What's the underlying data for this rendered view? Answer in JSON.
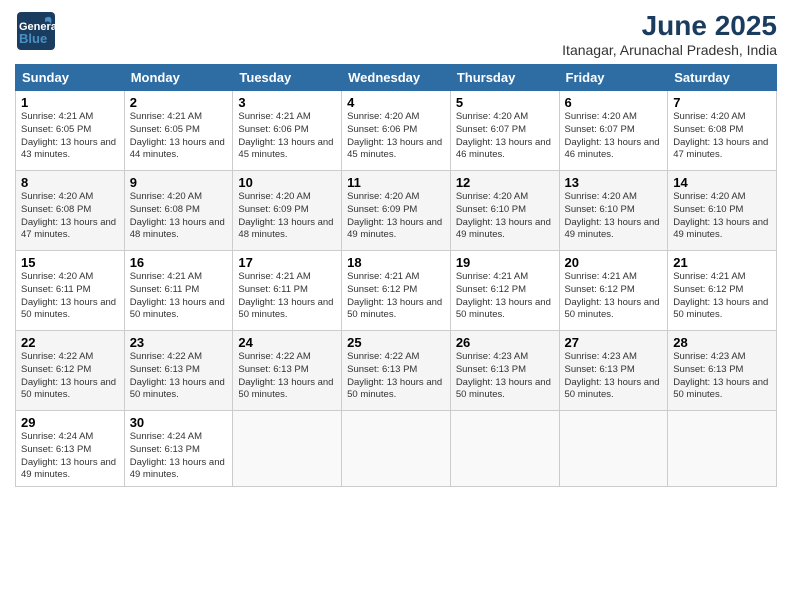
{
  "header": {
    "logo_general": "General",
    "logo_blue": "Blue",
    "month_year": "June 2025",
    "location": "Itanagar, Arunachal Pradesh, India"
  },
  "weekdays": [
    "Sunday",
    "Monday",
    "Tuesday",
    "Wednesday",
    "Thursday",
    "Friday",
    "Saturday"
  ],
  "weeks": [
    [
      {
        "day": "1",
        "sunrise": "4:21 AM",
        "sunset": "6:05 PM",
        "daylight": "13 hours and 43 minutes."
      },
      {
        "day": "2",
        "sunrise": "4:21 AM",
        "sunset": "6:05 PM",
        "daylight": "13 hours and 44 minutes."
      },
      {
        "day": "3",
        "sunrise": "4:21 AM",
        "sunset": "6:06 PM",
        "daylight": "13 hours and 45 minutes."
      },
      {
        "day": "4",
        "sunrise": "4:20 AM",
        "sunset": "6:06 PM",
        "daylight": "13 hours and 45 minutes."
      },
      {
        "day": "5",
        "sunrise": "4:20 AM",
        "sunset": "6:07 PM",
        "daylight": "13 hours and 46 minutes."
      },
      {
        "day": "6",
        "sunrise": "4:20 AM",
        "sunset": "6:07 PM",
        "daylight": "13 hours and 46 minutes."
      },
      {
        "day": "7",
        "sunrise": "4:20 AM",
        "sunset": "6:08 PM",
        "daylight": "13 hours and 47 minutes."
      }
    ],
    [
      {
        "day": "8",
        "sunrise": "4:20 AM",
        "sunset": "6:08 PM",
        "daylight": "13 hours and 47 minutes."
      },
      {
        "day": "9",
        "sunrise": "4:20 AM",
        "sunset": "6:08 PM",
        "daylight": "13 hours and 48 minutes."
      },
      {
        "day": "10",
        "sunrise": "4:20 AM",
        "sunset": "6:09 PM",
        "daylight": "13 hours and 48 minutes."
      },
      {
        "day": "11",
        "sunrise": "4:20 AM",
        "sunset": "6:09 PM",
        "daylight": "13 hours and 49 minutes."
      },
      {
        "day": "12",
        "sunrise": "4:20 AM",
        "sunset": "6:10 PM",
        "daylight": "13 hours and 49 minutes."
      },
      {
        "day": "13",
        "sunrise": "4:20 AM",
        "sunset": "6:10 PM",
        "daylight": "13 hours and 49 minutes."
      },
      {
        "day": "14",
        "sunrise": "4:20 AM",
        "sunset": "6:10 PM",
        "daylight": "13 hours and 49 minutes."
      }
    ],
    [
      {
        "day": "15",
        "sunrise": "4:20 AM",
        "sunset": "6:11 PM",
        "daylight": "13 hours and 50 minutes."
      },
      {
        "day": "16",
        "sunrise": "4:21 AM",
        "sunset": "6:11 PM",
        "daylight": "13 hours and 50 minutes."
      },
      {
        "day": "17",
        "sunrise": "4:21 AM",
        "sunset": "6:11 PM",
        "daylight": "13 hours and 50 minutes."
      },
      {
        "day": "18",
        "sunrise": "4:21 AM",
        "sunset": "6:12 PM",
        "daylight": "13 hours and 50 minutes."
      },
      {
        "day": "19",
        "sunrise": "4:21 AM",
        "sunset": "6:12 PM",
        "daylight": "13 hours and 50 minutes."
      },
      {
        "day": "20",
        "sunrise": "4:21 AM",
        "sunset": "6:12 PM",
        "daylight": "13 hours and 50 minutes."
      },
      {
        "day": "21",
        "sunrise": "4:21 AM",
        "sunset": "6:12 PM",
        "daylight": "13 hours and 50 minutes."
      }
    ],
    [
      {
        "day": "22",
        "sunrise": "4:22 AM",
        "sunset": "6:12 PM",
        "daylight": "13 hours and 50 minutes."
      },
      {
        "day": "23",
        "sunrise": "4:22 AM",
        "sunset": "6:13 PM",
        "daylight": "13 hours and 50 minutes."
      },
      {
        "day": "24",
        "sunrise": "4:22 AM",
        "sunset": "6:13 PM",
        "daylight": "13 hours and 50 minutes."
      },
      {
        "day": "25",
        "sunrise": "4:22 AM",
        "sunset": "6:13 PM",
        "daylight": "13 hours and 50 minutes."
      },
      {
        "day": "26",
        "sunrise": "4:23 AM",
        "sunset": "6:13 PM",
        "daylight": "13 hours and 50 minutes."
      },
      {
        "day": "27",
        "sunrise": "4:23 AM",
        "sunset": "6:13 PM",
        "daylight": "13 hours and 50 minutes."
      },
      {
        "day": "28",
        "sunrise": "4:23 AM",
        "sunset": "6:13 PM",
        "daylight": "13 hours and 50 minutes."
      }
    ],
    [
      {
        "day": "29",
        "sunrise": "4:24 AM",
        "sunset": "6:13 PM",
        "daylight": "13 hours and 49 minutes."
      },
      {
        "day": "30",
        "sunrise": "4:24 AM",
        "sunset": "6:13 PM",
        "daylight": "13 hours and 49 minutes."
      },
      null,
      null,
      null,
      null,
      null
    ]
  ]
}
